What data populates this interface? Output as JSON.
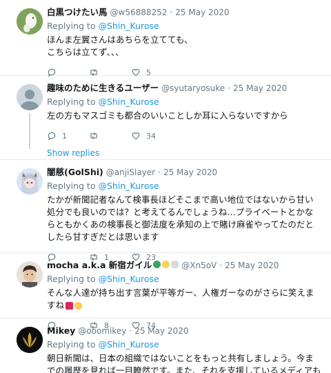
{
  "tweets": [
    {
      "name": "白黒つけたい馬",
      "handle": "@w56888252",
      "sep": "·",
      "date": "25 May 2020",
      "replying_prefix": "Replying to ",
      "replying_to": "@Shin_Kurose",
      "body": "ほんま左翼さんはあちらを立てても、\nこちらは立てず、、、",
      "reply_count": "",
      "retweet_count": "",
      "like_count": "5",
      "avatar": "white-horse"
    },
    {
      "name": "趣味のために生きるユーザー",
      "handle": "@syutaryosuke",
      "sep": "·",
      "date": "25 May 2020",
      "replying_prefix": "Replying to ",
      "replying_to": "@Shin_Kurose",
      "body": "左の方もマスゴミも都合のいいことしか耳に入らないですから",
      "reply_count": "1",
      "retweet_count": "",
      "like_count": "34",
      "show_replies": "Show replies",
      "avatar": "default"
    },
    {
      "name": "闇慈(GolShi)",
      "handle": "@anjiSlayer",
      "sep": "·",
      "date": "25 May 2020",
      "replying_prefix": "Replying to ",
      "replying_to": "@Shin_Kurose",
      "body": "たかが新聞記者なんて検事長ほどそこまで高い地位ではないから甘い処分でも良いのでは？と考えてるんでしょうね…プライベートとかならともかくあの検事長と御法度を承知の上で賭け麻雀やってたのだとしたら甘すぎだとは思います",
      "reply_count": "",
      "retweet_count": "1",
      "like_count": "23",
      "avatar": "anime"
    },
    {
      "name": "mocha a.k.a 新宿ガイル",
      "handle": "@Xn5oV",
      "sep": "·",
      "date": "25 May 2020",
      "replying_prefix": "Replying to ",
      "replying_to": "@Shin_Kurose",
      "body": "そんな人達が持ち出す言葉が平等ガー、人権ガーなのがさらに笑えますね",
      "reply_count": "",
      "retweet_count": "8",
      "like_count": "74",
      "avatar": "person"
    },
    {
      "name": "Mikey",
      "handle": "@ooomikey",
      "sep": "·",
      "date": "25 May 2020",
      "replying_prefix": "Replying to ",
      "replying_to": "@Shin_Kurose",
      "body": "朝日新聞は、日本の組織ではないことをもっと共有しましょう。今までの履歴を見れば一目瞭然です。また、それを支援しているメディアも同様です。",
      "reply_count": "",
      "retweet_count": "",
      "like_count": "",
      "avatar": "dark-logo"
    }
  ],
  "emoji": {
    "t4_name_badges": [
      "green-badge",
      "yellow-badge",
      "rabbit"
    ],
    "t4_body_tail": [
      "interrobang",
      "winking-face"
    ]
  }
}
